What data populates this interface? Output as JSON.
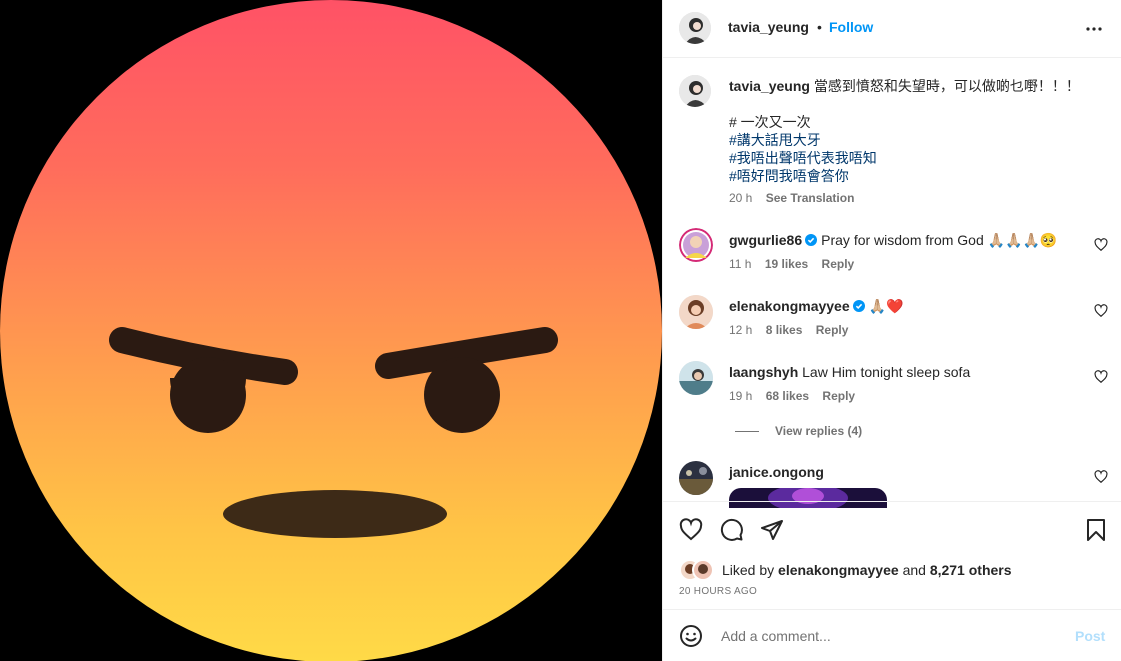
{
  "post": {
    "author": "tavia_yeung",
    "follow_label": "Follow",
    "dot": "•",
    "caption_text": "當感到憤怒和失望時，可以做啲乜嘢！！！",
    "caption_line2": "# 一次又一次",
    "hashtags": [
      "#講大話甩大牙",
      "#我唔出聲唔代表我唔知",
      "#唔好問我唔會答你"
    ],
    "time": "20 h",
    "see_translation": "See Translation"
  },
  "comments": [
    {
      "user": "gwgurlie86",
      "verified": true,
      "text": "Pray for wisdom from God 🙏🏼🙏🏼🙏🏼🥺",
      "time": "11 h",
      "likes": "19 likes",
      "reply": "Reply"
    },
    {
      "user": "elenakongmayyee",
      "verified": true,
      "text": "🙏🏼❤️",
      "time": "12 h",
      "likes": "8 likes",
      "reply": "Reply"
    },
    {
      "user": "laangshyh",
      "verified": false,
      "text": "Law Him tonight sleep sofa",
      "time": "19 h",
      "likes": "68 likes",
      "reply": "Reply",
      "view_replies": "View replies (4)"
    },
    {
      "user": "janice.ongong",
      "verified": false,
      "text": "",
      "time": "",
      "likes": "",
      "reply": ""
    }
  ],
  "likes": {
    "prefix": "Liked by",
    "user": "elenakongmayyee",
    "and": "and",
    "others": "8,271 others"
  },
  "posted_ago": "20 HOURS AGO",
  "comment_box": {
    "placeholder": "Add a comment...",
    "post_label": "Post"
  },
  "icons": {
    "more": "more-icon",
    "like": "heart-icon",
    "comment": "comment-icon",
    "share": "share-icon",
    "save": "bookmark-icon",
    "emoji": "emoji-icon"
  },
  "colors": {
    "link_blue": "#0095f6",
    "hashtag": "#00376b",
    "post_disabled": "#b2dffc"
  }
}
